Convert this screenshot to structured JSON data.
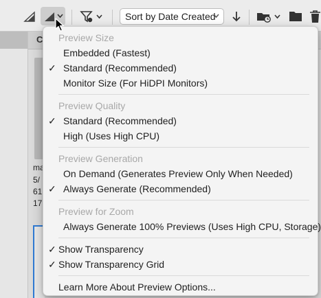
{
  "toolbar": {
    "sort_label": "Sort by Date Created"
  },
  "content": {
    "header_letter": "C",
    "thumb_lines": [
      "ma",
      "5/",
      "61",
      "17"
    ]
  },
  "menu": {
    "preview_size": {
      "heading": "Preview Size",
      "items": [
        {
          "label": "Embedded (Fastest)",
          "checked": false
        },
        {
          "label": "Standard (Recommended)",
          "checked": true
        },
        {
          "label": "Monitor Size (For HiDPI Monitors)",
          "checked": false
        }
      ]
    },
    "preview_quality": {
      "heading": "Preview Quality",
      "items": [
        {
          "label": "Standard (Recommended)",
          "checked": true
        },
        {
          "label": "High (Uses High CPU)",
          "checked": false
        }
      ]
    },
    "preview_generation": {
      "heading": "Preview Generation",
      "items": [
        {
          "label": "On Demand (Generates Preview Only When Needed)",
          "checked": false
        },
        {
          "label": "Always Generate (Recommended)",
          "checked": true
        }
      ]
    },
    "preview_zoom": {
      "heading": "Preview for Zoom",
      "items": [
        {
          "label": "Always Generate 100% Previews (Uses High CPU, Storage)",
          "checked": false
        }
      ]
    },
    "toggles": [
      {
        "label": "Show Transparency",
        "checked": true
      },
      {
        "label": "Show Transparency Grid",
        "checked": true
      }
    ],
    "learn_more": "Learn More About Preview Options...",
    "check_glyph": "✓"
  }
}
